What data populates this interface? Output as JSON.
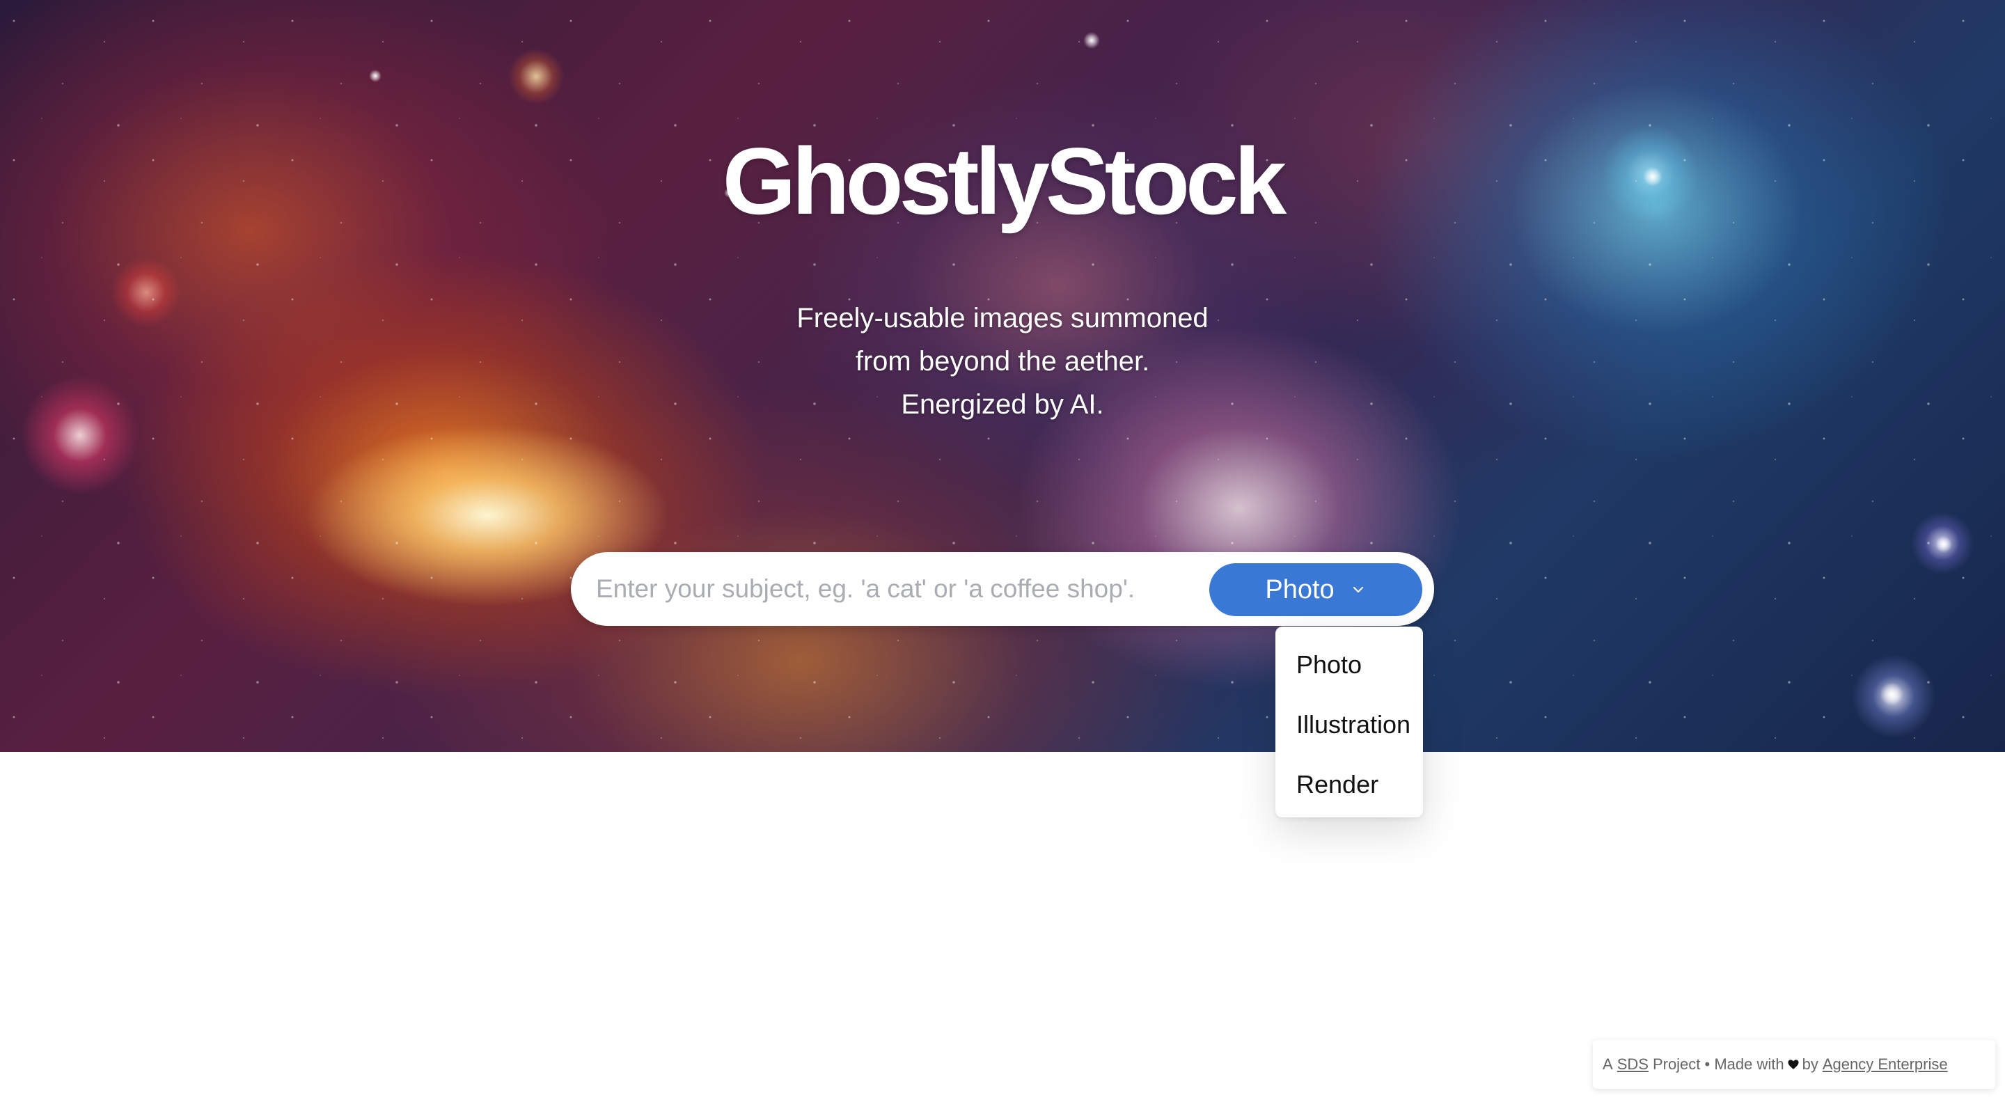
{
  "hero": {
    "logo": "GhostlyStock",
    "tagline_lines": [
      "Freely-usable images summoned",
      "from beyond the aether.",
      "Energized by AI."
    ]
  },
  "search": {
    "placeholder": "Enter your subject, eg. 'a cat' or 'a coffee shop'.",
    "value": ""
  },
  "image_type": {
    "selected": "Photo",
    "chevron_icon": "chevron-down-icon",
    "options": [
      "Photo",
      "Illustration",
      "Render"
    ]
  },
  "footer": {
    "prefix": "A",
    "sds_link": "SDS",
    "project_text": "Project • Made with",
    "heart_icon": "heart-icon",
    "by_text": "by",
    "agency_link": "Agency Enterprise"
  },
  "colors": {
    "accent": "#3a78d6",
    "background": "#ffffff"
  }
}
